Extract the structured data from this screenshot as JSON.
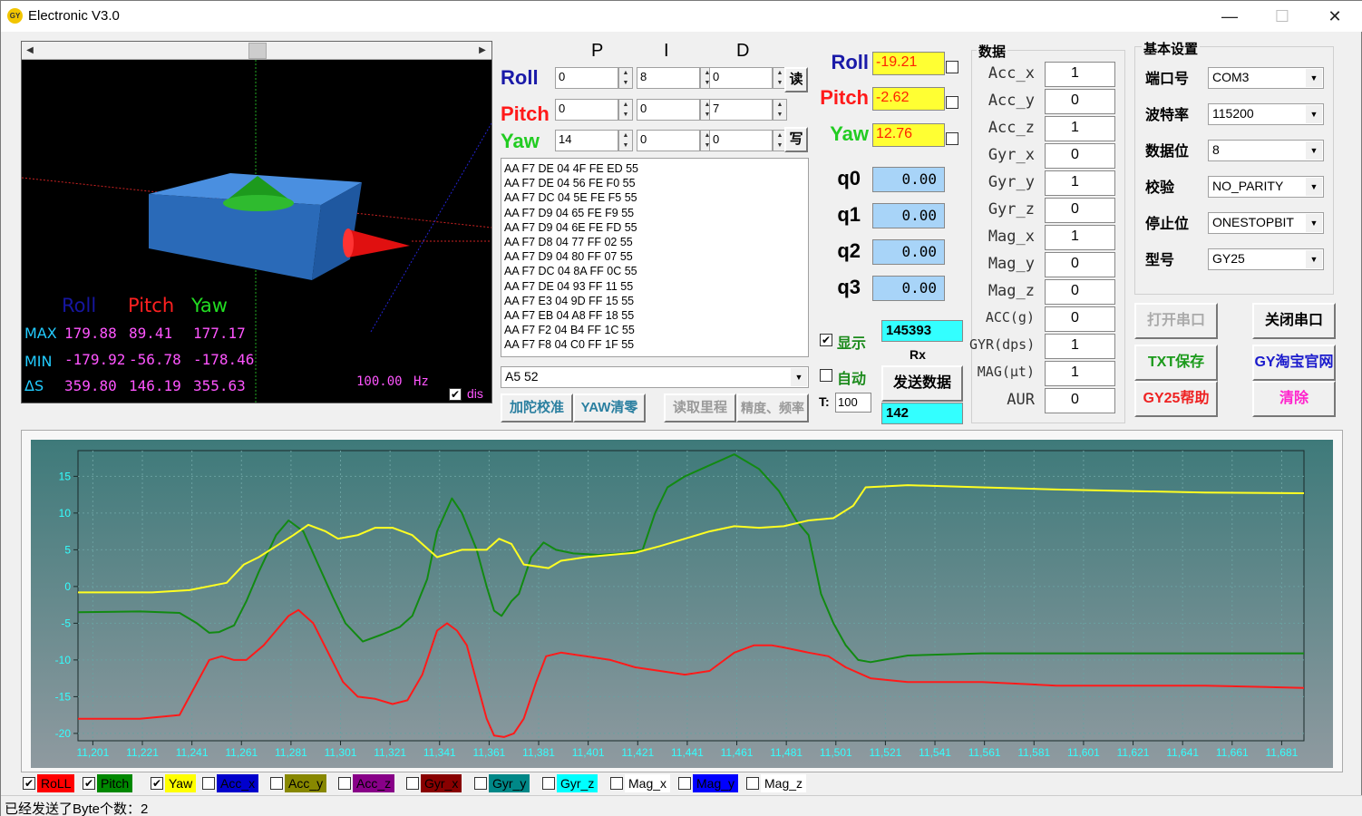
{
  "window": {
    "title": "Electronic V3.0",
    "icon_text": "GY"
  },
  "view3d": {
    "headers": {
      "roll": "Roll",
      "pitch": "Pitch",
      "yaw": "Yaw"
    },
    "rows": [
      {
        "label": "MAX",
        "roll": "179.88",
        "pitch": "89.41",
        "yaw": "177.17"
      },
      {
        "label": "MIN",
        "roll": "-179.92",
        "pitch": "-56.78",
        "yaw": "-178.46"
      },
      {
        "label": "ΔS",
        "roll": "359.80",
        "pitch": "146.19",
        "yaw": "355.63"
      }
    ],
    "hz_value": "100.00",
    "hz_unit": "Hz",
    "dis_label": "dis",
    "dis_checked": true
  },
  "pid": {
    "headers": {
      "p": "P",
      "i": "I",
      "d": "D"
    },
    "rows": [
      {
        "label": "Roll",
        "color": "#1a1aa8",
        "p": "0",
        "i": "8",
        "d": "0"
      },
      {
        "label": "Pitch",
        "color": "#ff1a1a",
        "p": "0",
        "i": "0",
        "d": "7"
      },
      {
        "label": "Yaw",
        "color": "#22cc22",
        "p": "14",
        "i": "0",
        "d": "0"
      }
    ],
    "read_label": "读",
    "write_label": "写"
  },
  "log_lines": [
    "AA F7 DE 04 4F FE ED 55",
    "AA F7 DE 04 56 FE F0 55",
    "AA F7 DC 04 5E FE F5 55",
    "AA F7 D9 04 65 FE F9 55",
    "AA F7 D9 04 6E FE FD 55",
    "AA F7 D8 04 77 FF 02 55",
    "AA F7 D9 04 80 FF 07 55",
    "AA F7 DC 04 8A FF 0C 55",
    "AA F7 DE 04 93 FF 11 55",
    "AA F7 E3 04 9D FF 15 55",
    "AA F7 EB 04 A8 FF 18 55",
    "AA F7 F2 04 B4 FF 1C 55",
    "AA F7 F8 04 C0 FF 1F 55"
  ],
  "command": {
    "value": "A5 52"
  },
  "cmd_buttons": {
    "gyro_cal": "加陀校准",
    "yaw_zero": "YAW清零",
    "read_odo": "读取里程",
    "precision": "精度、频率"
  },
  "angles": [
    {
      "label": "Roll",
      "color": "#1a1aa8",
      "value": "-19.21"
    },
    {
      "label": "Pitch",
      "color": "#ff1a1a",
      "value": "-2.62"
    },
    {
      "label": "Yaw",
      "color": "#22cc22",
      "value": "12.76"
    }
  ],
  "quaternions": [
    {
      "label": "q0",
      "value": "0.00"
    },
    {
      "label": "q1",
      "value": "0.00"
    },
    {
      "label": "q2",
      "value": "0.00"
    },
    {
      "label": "q3",
      "value": "0.00"
    }
  ],
  "display": {
    "show_label": "显示",
    "show_checked": true,
    "auto_label": "自动",
    "auto_checked": false,
    "t_label": "T:",
    "t_value": "100"
  },
  "rx": {
    "count": "145393",
    "label": "Rx",
    "send_button": "发送数据",
    "tx_count": "142"
  },
  "data_group": {
    "title": "数据",
    "rows": [
      {
        "label": "Acc_x",
        "value": "1"
      },
      {
        "label": "Acc_y",
        "value": "0"
      },
      {
        "label": "Acc_z",
        "value": "1"
      },
      {
        "label": "Gyr_x",
        "value": "0"
      },
      {
        "label": "Gyr_y",
        "value": "1"
      },
      {
        "label": "Gyr_z",
        "value": "0"
      },
      {
        "label": "Mag_x",
        "value": "1"
      },
      {
        "label": "Mag_y",
        "value": "0"
      },
      {
        "label": "Mag_z",
        "value": "0"
      },
      {
        "label": "ACC(g)",
        "value": "0"
      },
      {
        "label": "GYR(dps)",
        "value": "1"
      },
      {
        "label": "MAG(μt)",
        "value": "1"
      },
      {
        "label": "AUR",
        "value": "0"
      }
    ]
  },
  "settings": {
    "title": "基本设置",
    "rows": [
      {
        "label": "端口号",
        "value": "COM3"
      },
      {
        "label": "波特率",
        "value": "115200"
      },
      {
        "label": "数据位",
        "value": "8"
      },
      {
        "label": "校验",
        "value": "NO_PARITY"
      },
      {
        "label": "停止位",
        "value": "ONESTOPBIT"
      },
      {
        "label": "型号",
        "value": "GY25"
      }
    ],
    "buttons": {
      "open_port": "打开串口",
      "close_port": "关闭串口",
      "txt_save": "TXT保存",
      "taobao": "GY淘宝官网",
      "help": "GY25帮助",
      "clear": "清除"
    }
  },
  "legend": [
    {
      "label": "RoLL",
      "bg": "#ff0000",
      "fg": "#000000",
      "checked": true
    },
    {
      "label": "Pitch",
      "bg": "#008800",
      "fg": "#000000",
      "checked": true
    },
    {
      "label": "Yaw",
      "bg": "#ffff00",
      "fg": "#000000",
      "checked": true
    },
    {
      "label": "Acc_x",
      "bg": "#0000cc",
      "fg": "#000000",
      "checked": false
    },
    {
      "label": "Acc_y",
      "bg": "#888800",
      "fg": "#000000",
      "checked": false
    },
    {
      "label": "Acc_z",
      "bg": "#880088",
      "fg": "#000000",
      "checked": false
    },
    {
      "label": "Gyr_x",
      "bg": "#880000",
      "fg": "#000000",
      "checked": false
    },
    {
      "label": "Gyr_y",
      "bg": "#008888",
      "fg": "#000000",
      "checked": false
    },
    {
      "label": "Gyr_z",
      "bg": "#00ffff",
      "fg": "#000000",
      "checked": false
    },
    {
      "label": "Mag_x",
      "bg": "#ffffff",
      "fg": "#000000",
      "checked": false
    },
    {
      "label": "Mag_y",
      "bg": "#0000ff",
      "fg": "#000000",
      "checked": false
    },
    {
      "label": "Mag_z",
      "bg": "#ffffff",
      "fg": "#000000",
      "checked": false
    }
  ],
  "status": {
    "text": "已经发送了Byte个数：2"
  },
  "chart_data": {
    "type": "line",
    "x_ticks": [
      "11,201",
      "11,221",
      "11,241",
      "11,261",
      "11,281",
      "11,301",
      "11,321",
      "11,341",
      "11,361",
      "11,381",
      "11,401",
      "11,421",
      "11,441",
      "11,461",
      "11,481",
      "11,501",
      "11,521",
      "11,541",
      "11,561",
      "11,581",
      "11,601",
      "11,621",
      "11,641",
      "11,661",
      "11,681"
    ],
    "y_ticks": [
      15,
      10,
      5,
      0,
      -5,
      -10,
      -15,
      -20
    ],
    "xlim": [
      11195,
      11690
    ],
    "ylim": [
      -21,
      18.5
    ],
    "grid": true,
    "series": [
      {
        "color": "#ff1a1a",
        "x": [
          11195,
          11220,
          11236,
          11240,
          11248,
          11253,
          11258,
          11263,
          11270,
          11275,
          11280,
          11284,
          11290,
          11296,
          11302,
          11308,
          11315,
          11322,
          11328,
          11334,
          11340,
          11344,
          11348,
          11352,
          11356,
          11360,
          11363,
          11367,
          11371,
          11375,
          11380,
          11384,
          11390,
          11400,
          11410,
          11420,
          11430,
          11440,
          11450,
          11460,
          11468,
          11475,
          11480,
          11490,
          11498,
          11505,
          11515,
          11530,
          11560,
          11590,
          11620,
          11650,
          11690
        ],
        "values": [
          -18,
          -18,
          -17.5,
          -15,
          -10,
          -9.5,
          -10,
          -10,
          -8,
          -6,
          -4,
          -3.2,
          -5,
          -9,
          -13,
          -15,
          -15.3,
          -16,
          -15.5,
          -12,
          -6,
          -5,
          -6,
          -8,
          -13,
          -18,
          -20.3,
          -20.5,
          -20,
          -18,
          -13,
          -9.5,
          -9,
          -9.5,
          -10,
          -11,
          -11.5,
          -12,
          -11.5,
          -9,
          -8,
          -8,
          -8.3,
          -9,
          -9.5,
          -11,
          -12.5,
          -13,
          -13,
          -13.5,
          -13.5,
          -13.5,
          -13.8
        ]
      },
      {
        "color": "#128a12",
        "x": [
          11195,
          11220,
          11236,
          11243,
          11248,
          11252,
          11258,
          11263,
          11268,
          11275,
          11280,
          11286,
          11292,
          11298,
          11303,
          11310,
          11318,
          11325,
          11330,
          11336,
          11340,
          11346,
          11350,
          11356,
          11360,
          11363,
          11366,
          11370,
          11373,
          11378,
          11383,
          11388,
          11395,
          11405,
          11415,
          11423,
          11428,
          11433,
          11440,
          11450,
          11460,
          11470,
          11478,
          11485,
          11490,
          11495,
          11500,
          11505,
          11510,
          11515,
          11520,
          11530,
          11560,
          11600,
          11650,
          11690
        ],
        "values": [
          -3.5,
          -3.4,
          -3.6,
          -5,
          -6.3,
          -6.2,
          -5.3,
          -2,
          2,
          7,
          9,
          7.5,
          3,
          -1.5,
          -5,
          -7.5,
          -6.5,
          -5.5,
          -4,
          1,
          7.5,
          12,
          10,
          5,
          0,
          -3.3,
          -4,
          -2,
          -1,
          4,
          6,
          5,
          4.5,
          4.3,
          4.5,
          5,
          10,
          13.5,
          15,
          16.5,
          18,
          16,
          13,
          9,
          7,
          -1,
          -5,
          -8,
          -10,
          -10.3,
          -10,
          -9.4,
          -9.1,
          -9.1,
          -9.1,
          -9.1
        ]
      },
      {
        "color": "#ffff22",
        "x": [
          11195,
          11225,
          11240,
          11255,
          11262,
          11268,
          11275,
          11282,
          11288,
          11295,
          11300,
          11308,
          11315,
          11322,
          11330,
          11340,
          11350,
          11360,
          11365,
          11370,
          11375,
          11385,
          11390,
          11400,
          11410,
          11420,
          11430,
          11440,
          11450,
          11460,
          11470,
          11480,
          11490,
          11500,
          11508,
          11513,
          11530,
          11560,
          11590,
          11620,
          11650,
          11690
        ],
        "values": [
          -0.8,
          -0.8,
          -0.5,
          0.5,
          3,
          4,
          5.5,
          7,
          8.4,
          7.5,
          6.5,
          7,
          8,
          8,
          7,
          4,
          5,
          5,
          6.5,
          5.8,
          3,
          2.5,
          3.5,
          4,
          4.3,
          4.6,
          5.5,
          6.5,
          7.5,
          8.2,
          8,
          8.2,
          9,
          9.3,
          11,
          13.5,
          13.8,
          13.5,
          13.2,
          13,
          12.8,
          12.7
        ]
      }
    ]
  }
}
